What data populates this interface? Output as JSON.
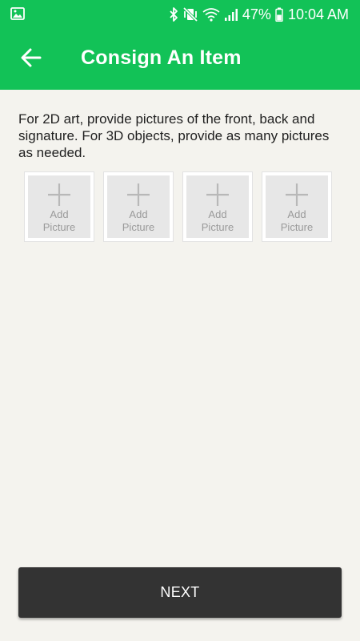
{
  "status_bar": {
    "left_icons": [
      "gallery-icon"
    ],
    "right_icons": [
      "bluetooth-icon",
      "vibrate-off-icon",
      "wifi-icon",
      "signal-icon",
      "battery-icon"
    ],
    "battery_percent": "47%",
    "time": "10:04 AM"
  },
  "app_bar": {
    "back_icon": "arrow-left-icon",
    "title": "Consign An Item"
  },
  "instructions": {
    "text": "For 2D art, provide pictures of the front, back and signature. For 3D objects, provide as many pictures as needed."
  },
  "picture_slots": [
    {
      "icon": "plus-icon",
      "label_line1": "Add",
      "label_line2": "Picture"
    },
    {
      "icon": "plus-icon",
      "label_line1": "Add",
      "label_line2": "Picture"
    },
    {
      "icon": "plus-icon",
      "label_line1": "Add",
      "label_line2": "Picture"
    },
    {
      "icon": "plus-icon",
      "label_line1": "Add",
      "label_line2": "Picture"
    }
  ],
  "footer": {
    "next_label": "NEXT"
  },
  "colors": {
    "primary_green": "#12c257",
    "background": "#f4f3ee",
    "next_button": "#333333",
    "slot_placeholder": "#e7e7e7",
    "slot_text": "#9a9a9a"
  }
}
